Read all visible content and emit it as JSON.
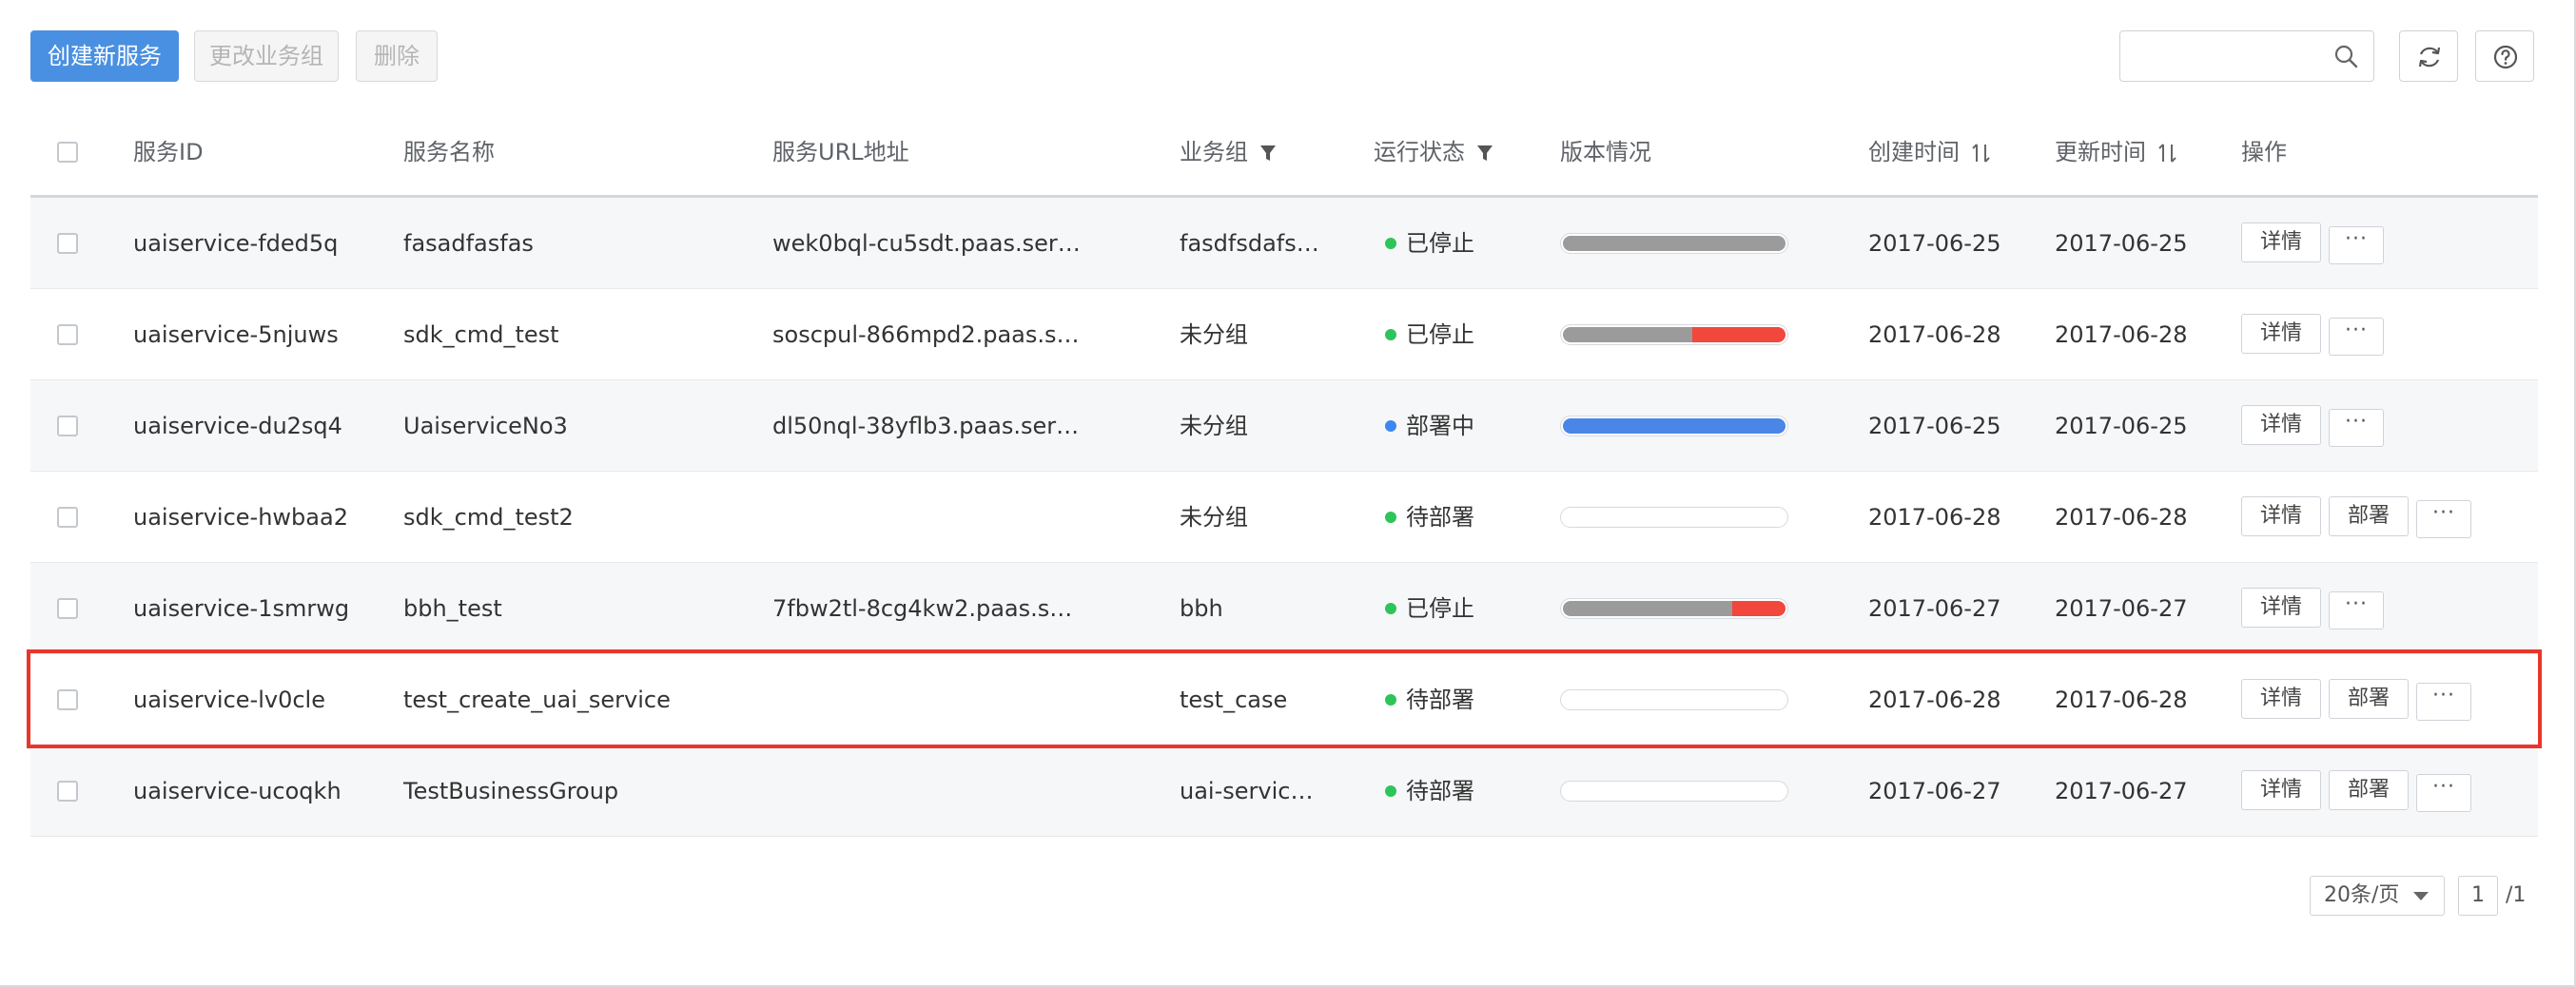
{
  "toolbar": {
    "create_label": "创建新服务",
    "change_group_label": "更改业务组",
    "delete_label": "删除",
    "search_placeholder": "",
    "search_value": ""
  },
  "colors": {
    "primary": "#4a90e2",
    "status_green": "#2ec45a",
    "status_blue": "#3d87f0",
    "progress_gray": "#9b9b9b",
    "progress_red": "#f2473d",
    "progress_blue": "#4a86e8",
    "highlight_red": "#e8362c"
  },
  "table": {
    "headers": {
      "id": "服务ID",
      "name": "服务名称",
      "url": "服务URL地址",
      "group": "业务组",
      "status": "运行状态",
      "version": "版本情况",
      "created": "创建时间",
      "updated": "更新时间",
      "ops": "操作"
    },
    "rows": [
      {
        "id": "uaiservice-fded5q",
        "name": "fasadfasfas",
        "url": "wek0bql-cu5sdt.paas.ser…",
        "group": "fasdfsdafs…",
        "status": "已停止",
        "status_color": "green",
        "version": {
          "gray": 1.0,
          "red": 0,
          "blue": 0
        },
        "created": "2017-06-25",
        "updated": "2017-06-25",
        "has_deploy": false
      },
      {
        "id": "uaiservice-5njuws",
        "name": "sdk_cmd_test",
        "url": "soscpul-866mpd2.paas.s…",
        "group": "未分组",
        "status": "已停止",
        "status_color": "green",
        "version": {
          "gray": 0.58,
          "red": 0.42,
          "blue": 0
        },
        "created": "2017-06-28",
        "updated": "2017-06-28",
        "has_deploy": false
      },
      {
        "id": "uaiservice-du2sq4",
        "name": "UaiserviceNo3",
        "url": "dl50nql-38yflb3.paas.ser…",
        "group": "未分组",
        "status": "部署中",
        "status_color": "blue",
        "version": {
          "gray": 0,
          "red": 0,
          "blue": 1.0
        },
        "created": "2017-06-25",
        "updated": "2017-06-25",
        "has_deploy": false
      },
      {
        "id": "uaiservice-hwbaa2",
        "name": "sdk_cmd_test2",
        "url": "",
        "group": "未分组",
        "status": "待部署",
        "status_color": "green",
        "version": {
          "gray": 0,
          "red": 0,
          "blue": 0
        },
        "created": "2017-06-28",
        "updated": "2017-06-28",
        "has_deploy": true
      },
      {
        "id": "uaiservice-1smrwg",
        "name": "bbh_test",
        "url": "7fbw2tl-8cg4kw2.paas.s…",
        "group": "bbh",
        "status": "已停止",
        "status_color": "green",
        "version": {
          "gray": 0.76,
          "red": 0.24,
          "blue": 0
        },
        "created": "2017-06-27",
        "updated": "2017-06-27",
        "has_deploy": false
      },
      {
        "id": "uaiservice-lv0cle",
        "name": "test_create_uai_service",
        "url": "",
        "group": "test_case",
        "status": "待部署",
        "status_color": "green",
        "version": {
          "gray": 0,
          "red": 0,
          "blue": 0
        },
        "created": "2017-06-28",
        "updated": "2017-06-28",
        "has_deploy": true
      },
      {
        "id": "uaiservice-ucoqkh",
        "name": "TestBusinessGroup",
        "url": "",
        "group": "uai-servic…",
        "status": "待部署",
        "status_color": "green",
        "version": {
          "gray": 0,
          "red": 0,
          "blue": 0
        },
        "created": "2017-06-27",
        "updated": "2017-06-27",
        "has_deploy": true
      }
    ],
    "detail_label": "详情",
    "deploy_label": "部署",
    "more_label": "···"
  },
  "pagination": {
    "page_size": "20条/页",
    "current_page": "1",
    "total": "/1"
  }
}
